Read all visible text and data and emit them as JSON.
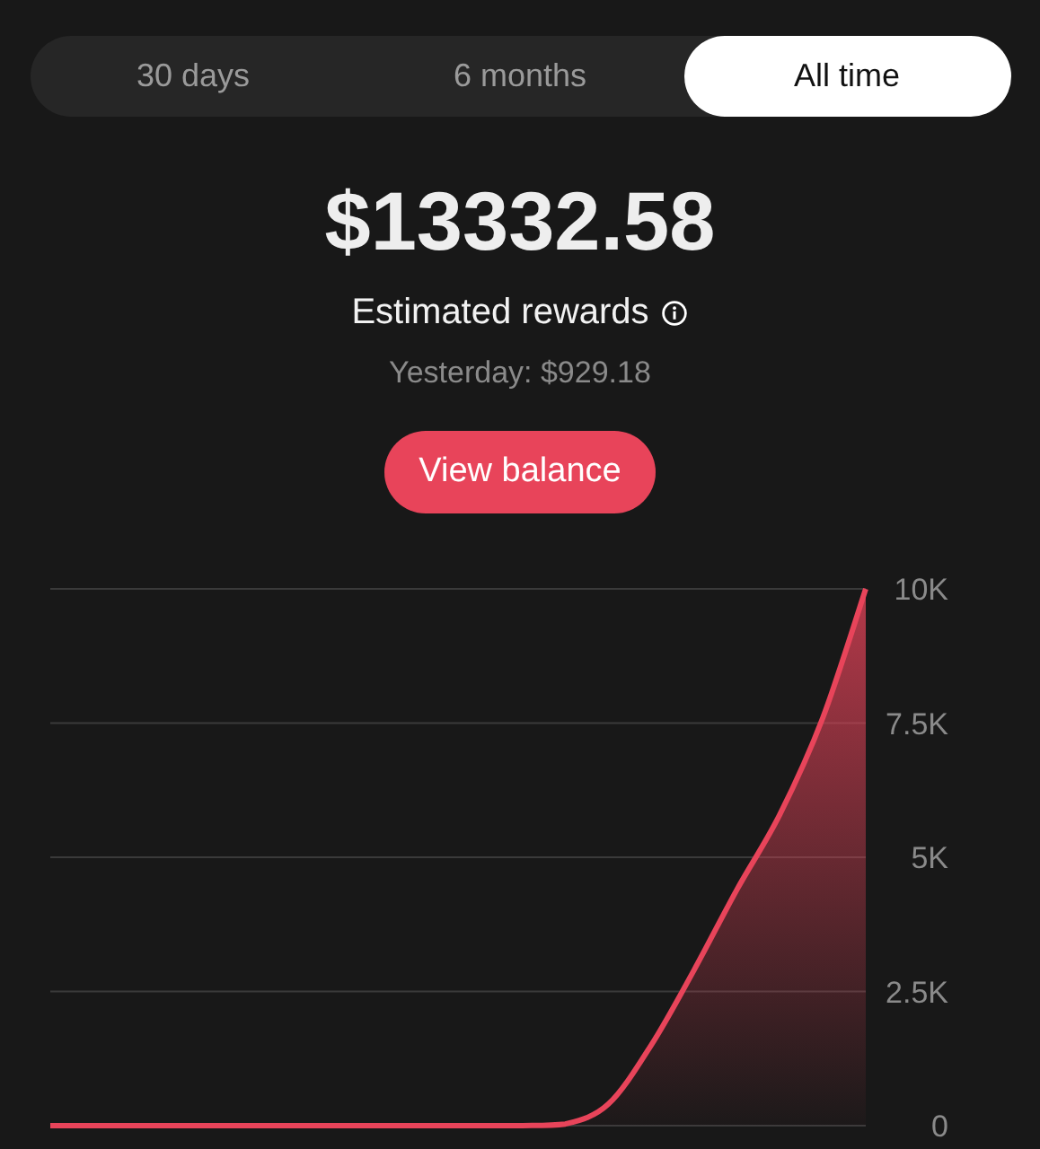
{
  "tabs": [
    {
      "label": "30 days",
      "selected": false
    },
    {
      "label": "6 months",
      "selected": false
    },
    {
      "label": "All time",
      "selected": true
    }
  ],
  "amount": "$13332.58",
  "rewards_label": "Estimated rewards",
  "yesterday": "Yesterday: $929.18",
  "view_balance_button": "View balance",
  "chart": {
    "chart_data": {
      "type": "area",
      "grid": true,
      "ylim": [
        0,
        10000
      ],
      "yticks": [
        {
          "value": 0,
          "label": "0"
        },
        {
          "value": 2500,
          "label": "2.5K"
        },
        {
          "value": 5000,
          "label": "5K"
        },
        {
          "value": 7500,
          "label": "7.5K"
        },
        {
          "value": 10000,
          "label": "10K"
        }
      ],
      "series": [
        {
          "color": "#e8445a",
          "values": [
            0,
            0,
            0,
            0,
            0,
            0,
            0,
            0,
            0,
            0,
            0,
            0,
            30,
            400,
            1500,
            2900,
            4400,
            5800,
            7600,
            10000
          ]
        }
      ]
    }
  }
}
